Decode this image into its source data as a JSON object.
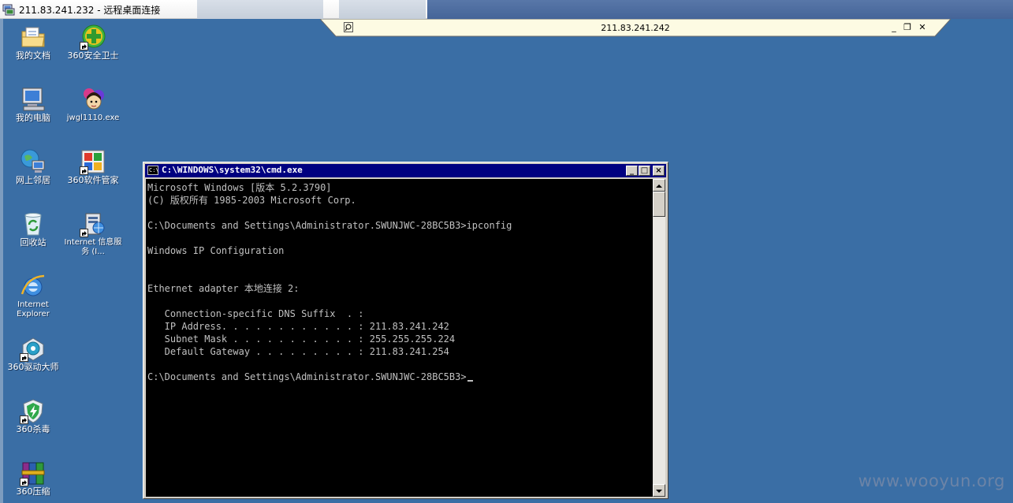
{
  "outer_window": {
    "title": "211.83.241.232 - 远程桌面连接"
  },
  "rdp_bar": {
    "host": "211.83.241.242",
    "minimize_label": "_",
    "restore_label": "❐",
    "close_label": "✕"
  },
  "desktop_icons": [
    {
      "label": "我的文档",
      "icon": "my-documents-folder-icon"
    },
    {
      "label": "360安全卫士",
      "icon": "360-safe-guard-icon"
    },
    {
      "label": "我的电脑",
      "icon": "my-computer-icon"
    },
    {
      "label": "jwgl1110.exe",
      "icon": "jwgl-exe-icon"
    },
    {
      "label": "网上邻居",
      "icon": "network-neighborhood-icon"
    },
    {
      "label": "360软件管家",
      "icon": "360-software-manager-icon"
    },
    {
      "label": "回收站",
      "icon": "recycle-bin-icon"
    },
    {
      "label": "Internet 信息服务 (I...",
      "icon": "iis-manager-icon"
    },
    {
      "label": "Internet Explorer",
      "icon": "internet-explorer-icon"
    },
    {
      "label": "360驱动大师",
      "icon": "360-driver-master-icon"
    },
    {
      "label": "360杀毒",
      "icon": "360-antivirus-icon"
    },
    {
      "label": "360压缩",
      "icon": "360-zip-icon"
    }
  ],
  "cmd_window": {
    "title": "C:\\WINDOWS\\system32\\cmd.exe",
    "icon_label": "C:\\",
    "minimize_label": "_",
    "maximize_label": "□",
    "close_label": "×",
    "lines": [
      "Microsoft Windows [版本 5.2.3790]",
      "(C) 版权所有 1985-2003 Microsoft Corp.",
      "",
      "C:\\Documents and Settings\\Administrator.SWUNJWC-28BC5B3>ipconfig",
      "",
      "Windows IP Configuration",
      "",
      "",
      "Ethernet adapter 本地连接 2:",
      "",
      "   Connection-specific DNS Suffix  . :",
      "   IP Address. . . . . . . . . . . . : 211.83.241.242",
      "   Subnet Mask . . . . . . . . . . . : 255.255.255.224",
      "   Default Gateway . . . . . . . . . : 211.83.241.254",
      "",
      "C:\\Documents and Settings\\Administrator.SWUNJWC-28BC5B3>"
    ]
  },
  "watermark": "www.wooyun.org"
}
